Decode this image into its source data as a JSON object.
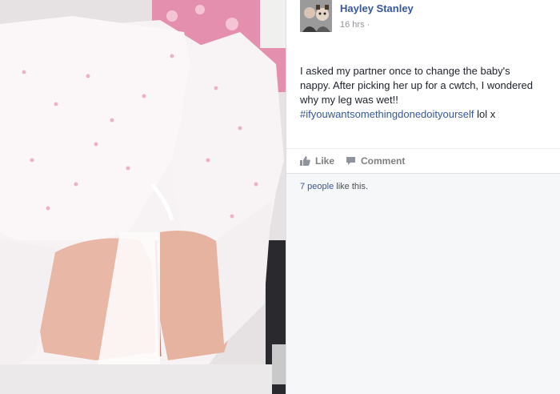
{
  "post": {
    "author": "Hayley Stanley",
    "timestamp": "16 hrs",
    "separator": "·",
    "text_lines": [
      "I asked my partner once to change the baby's",
      "nappy. After picking her up for a cwtch, I wondered",
      "why my leg was wet!!"
    ],
    "hashtag": "#ifyouwantsomethingdonedoityourself",
    "text_suffix": " lol x"
  },
  "actions": {
    "like_label": "Like",
    "comment_label": "Comment"
  },
  "likes": {
    "count_link": "7 people",
    "suffix": " like this."
  },
  "icons": {
    "avatar": "avatar-photo",
    "like": "thumbs-up-icon",
    "comment": "speech-bubble-icon"
  },
  "colors": {
    "link_blue": "#365899",
    "text": "#1d2129",
    "muted": "#90949c",
    "action_gray": "#7f7f7f",
    "panel_bg": "#f6f7f9"
  }
}
